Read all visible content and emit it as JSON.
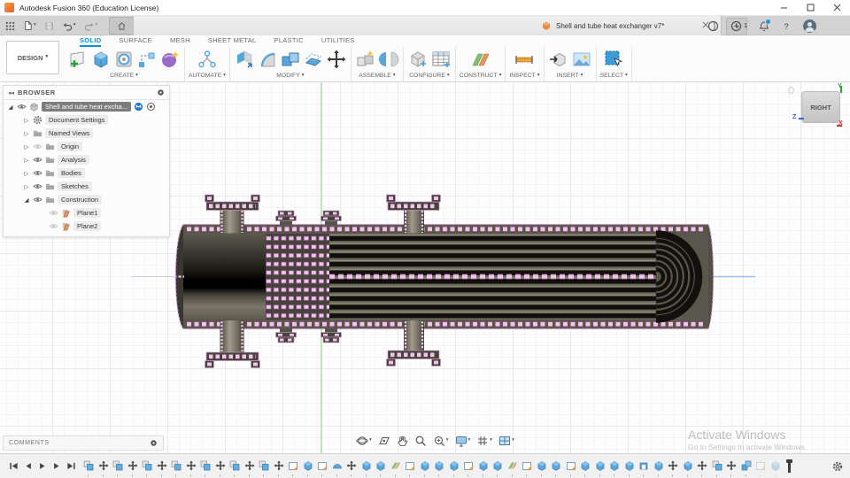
{
  "window": {
    "title": "Autodesk Fusion 360 (Education License)"
  },
  "tabbar": {
    "document_tab": "Shell and tube heat exchanger v7*",
    "new_tab_label": "+",
    "notification_count": "1"
  },
  "ribbon": {
    "design_button": "DESIGN",
    "tabs": [
      {
        "label": "SOLID",
        "active": true
      },
      {
        "label": "SURFACE",
        "active": false
      },
      {
        "label": "MESH",
        "active": false
      },
      {
        "label": "SHEET METAL",
        "active": false
      },
      {
        "label": "PLASTIC",
        "active": false
      },
      {
        "label": "UTILITIES",
        "active": false
      }
    ],
    "groups": [
      {
        "label": "CREATE",
        "icons": [
          "create-sketch-icon",
          "extrude-icon",
          "hole-icon",
          "pattern-path-icon",
          "form-icon"
        ]
      },
      {
        "label": "AUTOMATE",
        "icons": [
          "automate-icon"
        ]
      },
      {
        "label": "MODIFY",
        "icons": [
          "press-pull-icon",
          "fillet-icon",
          "combine-icon",
          "offset-face-icon",
          "move-icon"
        ]
      },
      {
        "label": "ASSEMBLE",
        "icons": [
          "new-component-icon",
          "joint-icon"
        ]
      },
      {
        "label": "CONFIGURE",
        "icons": [
          "configure-icon",
          "configuration-table-icon"
        ]
      },
      {
        "label": "CONSTRUCT",
        "icons": [
          "construct-plane-icon"
        ]
      },
      {
        "label": "INSPECT",
        "icons": [
          "measure-icon"
        ]
      },
      {
        "label": "INSERT",
        "icons": [
          "insert-derive-icon",
          "insert-image-icon"
        ]
      },
      {
        "label": "SELECT",
        "icons": [
          "select-icon"
        ]
      }
    ]
  },
  "browser": {
    "header": "BROWSER",
    "items": [
      {
        "label": "Shell and tube heat excha...",
        "arrow": "expanded",
        "eye": "on",
        "icon": "document-box-icon",
        "indent": 0,
        "selected": true,
        "extras": [
          "sync-icon",
          "focus-icon"
        ]
      },
      {
        "label": "Document Settings",
        "arrow": "collapsed",
        "eye": "none",
        "icon": "gear-icon",
        "indent": 1,
        "selected": false,
        "extras": []
      },
      {
        "label": "Named Views",
        "arrow": "collapsed",
        "eye": "none",
        "icon": "folder-icon",
        "indent": 1,
        "selected": false,
        "extras": []
      },
      {
        "label": "Origin",
        "arrow": "collapsed",
        "eye": "off",
        "icon": "folder-icon",
        "indent": 1,
        "selected": false,
        "extras": []
      },
      {
        "label": "Analysis",
        "arrow": "collapsed",
        "eye": "on",
        "icon": "folder-icon",
        "indent": 1,
        "selected": false,
        "extras": []
      },
      {
        "label": "Bodies",
        "arrow": "collapsed",
        "eye": "on",
        "icon": "folder-icon",
        "indent": 1,
        "selected": false,
        "extras": []
      },
      {
        "label": "Sketches",
        "arrow": "collapsed",
        "eye": "on",
        "icon": "folder-icon",
        "indent": 1,
        "selected": false,
        "extras": []
      },
      {
        "label": "Construction",
        "arrow": "expanded",
        "eye": "on",
        "icon": "folder-icon",
        "indent": 1,
        "selected": false,
        "extras": []
      },
      {
        "label": "Plane1",
        "arrow": "none",
        "eye": "off",
        "icon": "plane-icon",
        "indent": 2,
        "selected": false,
        "extras": []
      },
      {
        "label": "Plane2",
        "arrow": "none",
        "eye": "off",
        "icon": "plane-icon",
        "indent": 2,
        "selected": false,
        "extras": []
      }
    ]
  },
  "viewcube": {
    "face": "RIGHT",
    "axis_x": "X",
    "axis_y": "Y",
    "axis_z": "Z"
  },
  "navbar": {
    "icons": [
      {
        "name": "orbit-icon",
        "caret": true
      },
      {
        "name": "look-at-icon",
        "caret": false
      },
      {
        "name": "pan-icon",
        "caret": false
      },
      {
        "name": "zoom-icon",
        "caret": false
      },
      {
        "name": "fit-icon",
        "caret": true
      },
      {
        "name": "display-settings-icon",
        "caret": true
      },
      {
        "name": "grid-snaps-icon",
        "caret": true
      },
      {
        "name": "viewports-icon",
        "caret": true
      }
    ]
  },
  "comments": {
    "label": "COMMENTS"
  },
  "canvas": {
    "watermark_line1": "Activate Windows",
    "watermark_line2": "Go to Settings to activate Windows."
  },
  "timeline": {
    "items": [
      "component",
      "move",
      "component",
      "move",
      "component",
      "move",
      "component",
      "move",
      "component",
      "move",
      "component",
      "move",
      "component",
      "move",
      "sketch",
      "extrude",
      "sketch",
      "revolve",
      "move",
      "extrude",
      "extrude",
      "construct-plane",
      "sketch",
      "extrude",
      "extrude",
      "extrude",
      "sketch",
      "extrude",
      "extrude",
      "construct-plane",
      "sketch",
      "extrude",
      "extrude",
      "sketch",
      "extrude",
      "extrude",
      "extrude",
      "extrude",
      "shell-feature",
      "extrude",
      "move",
      "extrude",
      "move",
      "component",
      "move",
      "combine"
    ],
    "faded_items": [
      "sketch",
      "extrude"
    ]
  }
}
